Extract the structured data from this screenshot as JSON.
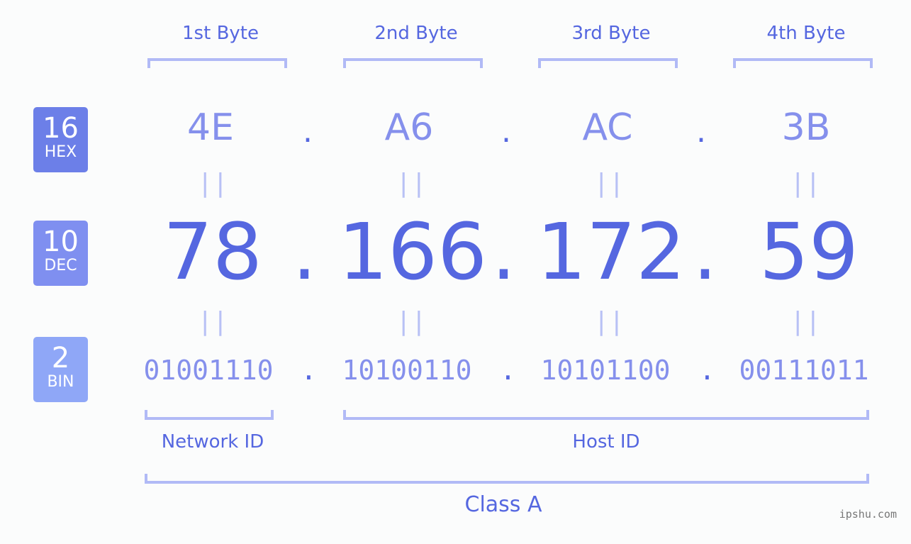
{
  "bytes": [
    {
      "label": "1st Byte",
      "hex": "4E",
      "dec": "78",
      "bin": "01001110"
    },
    {
      "label": "2nd Byte",
      "hex": "A6",
      "dec": "166",
      "bin": "10100110"
    },
    {
      "label": "3rd Byte",
      "hex": "AC",
      "dec": "172",
      "bin": "10101100"
    },
    {
      "label": "4th Byte",
      "hex": "3B",
      "dec": "59",
      "bin": "00111011"
    }
  ],
  "separator": ".",
  "equals": "||",
  "badges": {
    "hex": {
      "num": "16",
      "label": "HEX",
      "color": "#6c7fe8"
    },
    "dec": {
      "num": "10",
      "label": "DEC",
      "color": "#7f8ff0"
    },
    "bin": {
      "num": "2",
      "label": "BIN",
      "color": "#8fa7f7"
    }
  },
  "sections": {
    "network": "Network ID",
    "host": "Host ID",
    "class": "Class A"
  },
  "watermark": "ipshu.com"
}
